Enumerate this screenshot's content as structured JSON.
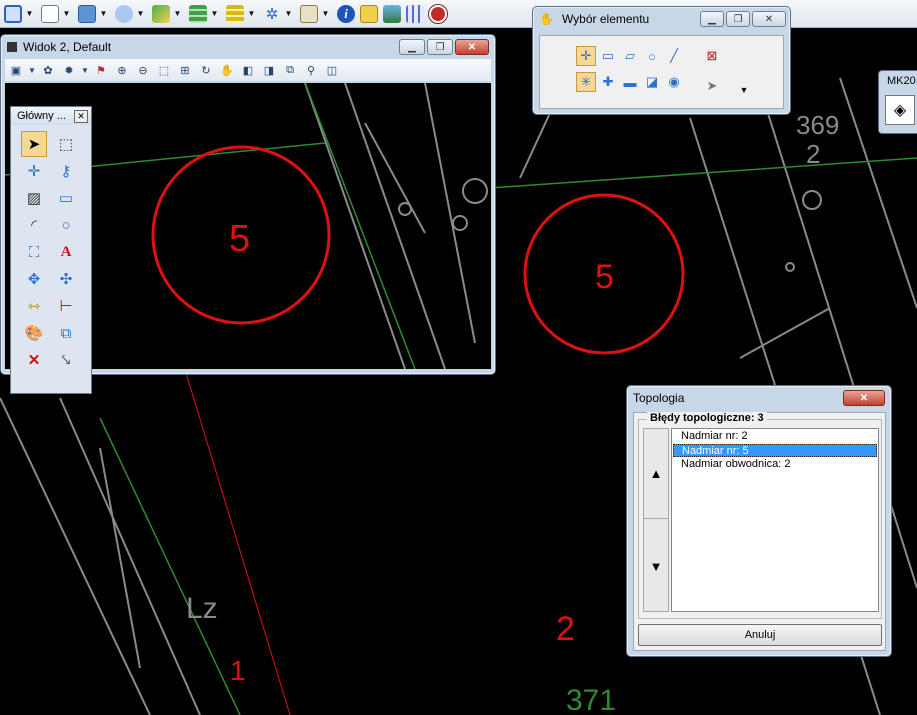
{
  "top_toolbar": {
    "icons": [
      "cube-icon",
      "document-icon",
      "table-icon",
      "cloud-icon",
      "image-icon",
      "layers-green-icon",
      "layers-yellow-icon",
      "cursor-sparkle-icon",
      "map-edit-icon",
      "info-icon",
      "search-doc-icon",
      "chart-icon",
      "grid-icon",
      "stop-icon"
    ]
  },
  "widok": {
    "title": "Widok 2, Default"
  },
  "glowny": {
    "title": "Główny ..."
  },
  "wybor": {
    "title": "Wybór elementu"
  },
  "mk": {
    "title": "MK20"
  },
  "topologia": {
    "title": "Topologia",
    "group_label": "Błędy topologiczne: 3",
    "items": [
      "Nadmiar nr: 2",
      "Nadmiar nr: 5",
      "Nadmiar obwodnica: 2"
    ],
    "selected_index": 1,
    "cancel_label": "Anuluj"
  },
  "map": {
    "labels": [
      "5",
      "5",
      "369",
      "2",
      "Lz",
      "2",
      "1",
      "371"
    ]
  },
  "colors": {
    "red": "#e01010",
    "green": "#2f8a2f",
    "grey": "#8a8a8a",
    "selection": "#3399ff"
  }
}
